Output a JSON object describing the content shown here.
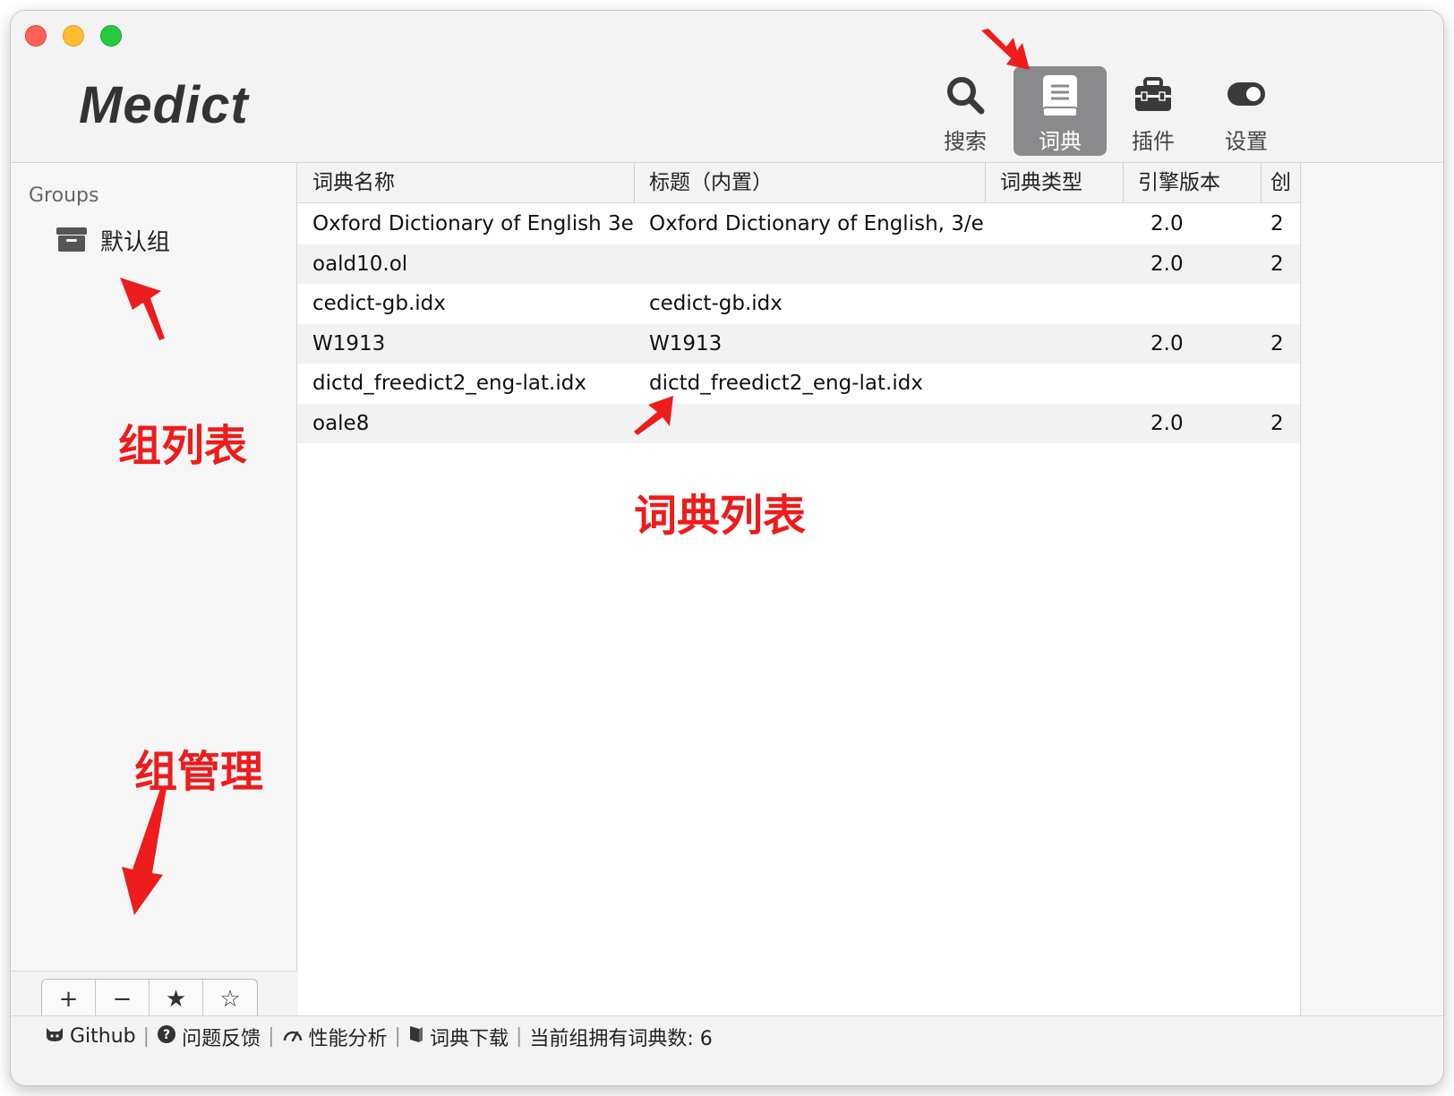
{
  "app": {
    "title": "Medict"
  },
  "toolbar": {
    "buttons": [
      {
        "label": "搜索",
        "icon": "search-icon"
      },
      {
        "label": "词典",
        "icon": "book-icon",
        "active": true
      },
      {
        "label": "插件",
        "icon": "toolbox-icon"
      },
      {
        "label": "设置",
        "icon": "toggle-icon"
      }
    ]
  },
  "sidebar": {
    "heading": "Groups",
    "groups": [
      {
        "label": "默认组",
        "icon": "archive-icon"
      }
    ],
    "controls": [
      "+",
      "−",
      "★",
      "☆"
    ]
  },
  "table": {
    "columns": [
      "词典名称",
      "标题（内置）",
      "词典类型",
      "引擎版本",
      "创"
    ],
    "rows": [
      {
        "name": "Oxford Dictionary of English 3e",
        "title": "Oxford Dictionary of English, 3/e",
        "type": "",
        "version": "2.0",
        "extra": "2"
      },
      {
        "name": "oald10.ol",
        "title": "",
        "type": "",
        "version": "2.0",
        "extra": "2"
      },
      {
        "name": "cedict-gb.idx",
        "title": "cedict-gb.idx",
        "type": "",
        "version": "",
        "extra": ""
      },
      {
        "name": "W1913",
        "title": "W1913",
        "type": "",
        "version": "2.0",
        "extra": "2"
      },
      {
        "name": "dictd_freedict2_eng-lat.idx",
        "title": "dictd_freedict2_eng-lat.idx",
        "type": "",
        "version": "",
        "extra": ""
      },
      {
        "name": "oale8",
        "title": "",
        "type": "",
        "version": "2.0",
        "extra": "2"
      }
    ]
  },
  "statusbar": {
    "items": [
      "Github",
      "问题反馈",
      "性能分析",
      "词典下载"
    ],
    "summary": "当前组拥有词典数: 6"
  },
  "annotations": {
    "group_list": "组列表",
    "dict_list": "词典列表",
    "group_manage": "组管理"
  },
  "colors": {
    "annotation": "#ee1c1c",
    "active_button": "#8a8a8c"
  }
}
